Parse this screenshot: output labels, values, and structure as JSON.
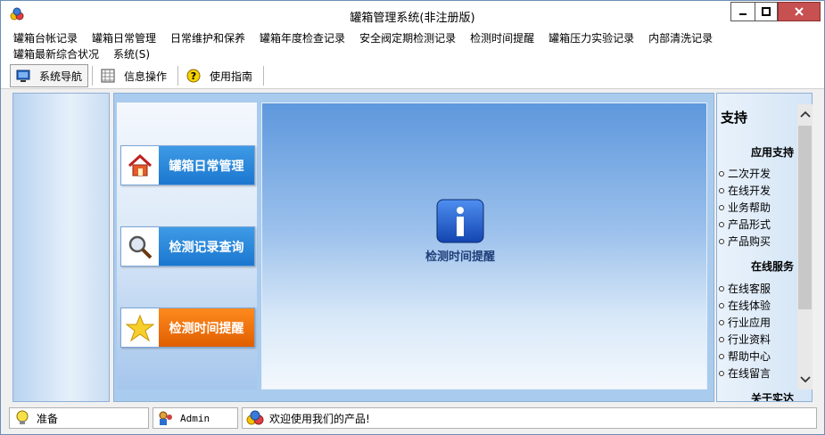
{
  "window": {
    "title": "罐箱管理系统(非注册版)"
  },
  "menu": {
    "row1": [
      "罐箱台帐记录",
      "罐箱日常管理",
      "日常维护和保养",
      "罐箱年度检查记录",
      "安全阀定期检测记录",
      "检测时间提醒",
      "罐箱压力实验记录",
      "内部清洗记录"
    ],
    "row2": [
      "罐箱最新综合状况",
      "系统(S)"
    ]
  },
  "toolbar": {
    "nav_label": "系统导航",
    "info_label": "信息操作",
    "guide_label": "使用指南"
  },
  "nav": {
    "btn1": "罐箱日常管理",
    "btn2": "检测记录查询",
    "btn3": "检测时间提醒"
  },
  "content": {
    "label": "检测时间提醒"
  },
  "right_panel": {
    "title": "支持",
    "section1": "应用支持",
    "links1": [
      "二次开发",
      "在线开发",
      "业务帮助",
      "产品形式",
      "产品购买"
    ],
    "section2": "在线服务",
    "links2": [
      "在线客服",
      "在线体验",
      "行业应用",
      "行业资料",
      "帮助中心",
      "在线留言"
    ],
    "section3": "关于实达"
  },
  "status": {
    "ready": "准备",
    "user": "Admin",
    "message": "欢迎使用我们的产品!"
  },
  "colors": {
    "accent_blue": "#1b77cf",
    "accent_orange": "#e05e00",
    "close_red": "#c75050"
  }
}
